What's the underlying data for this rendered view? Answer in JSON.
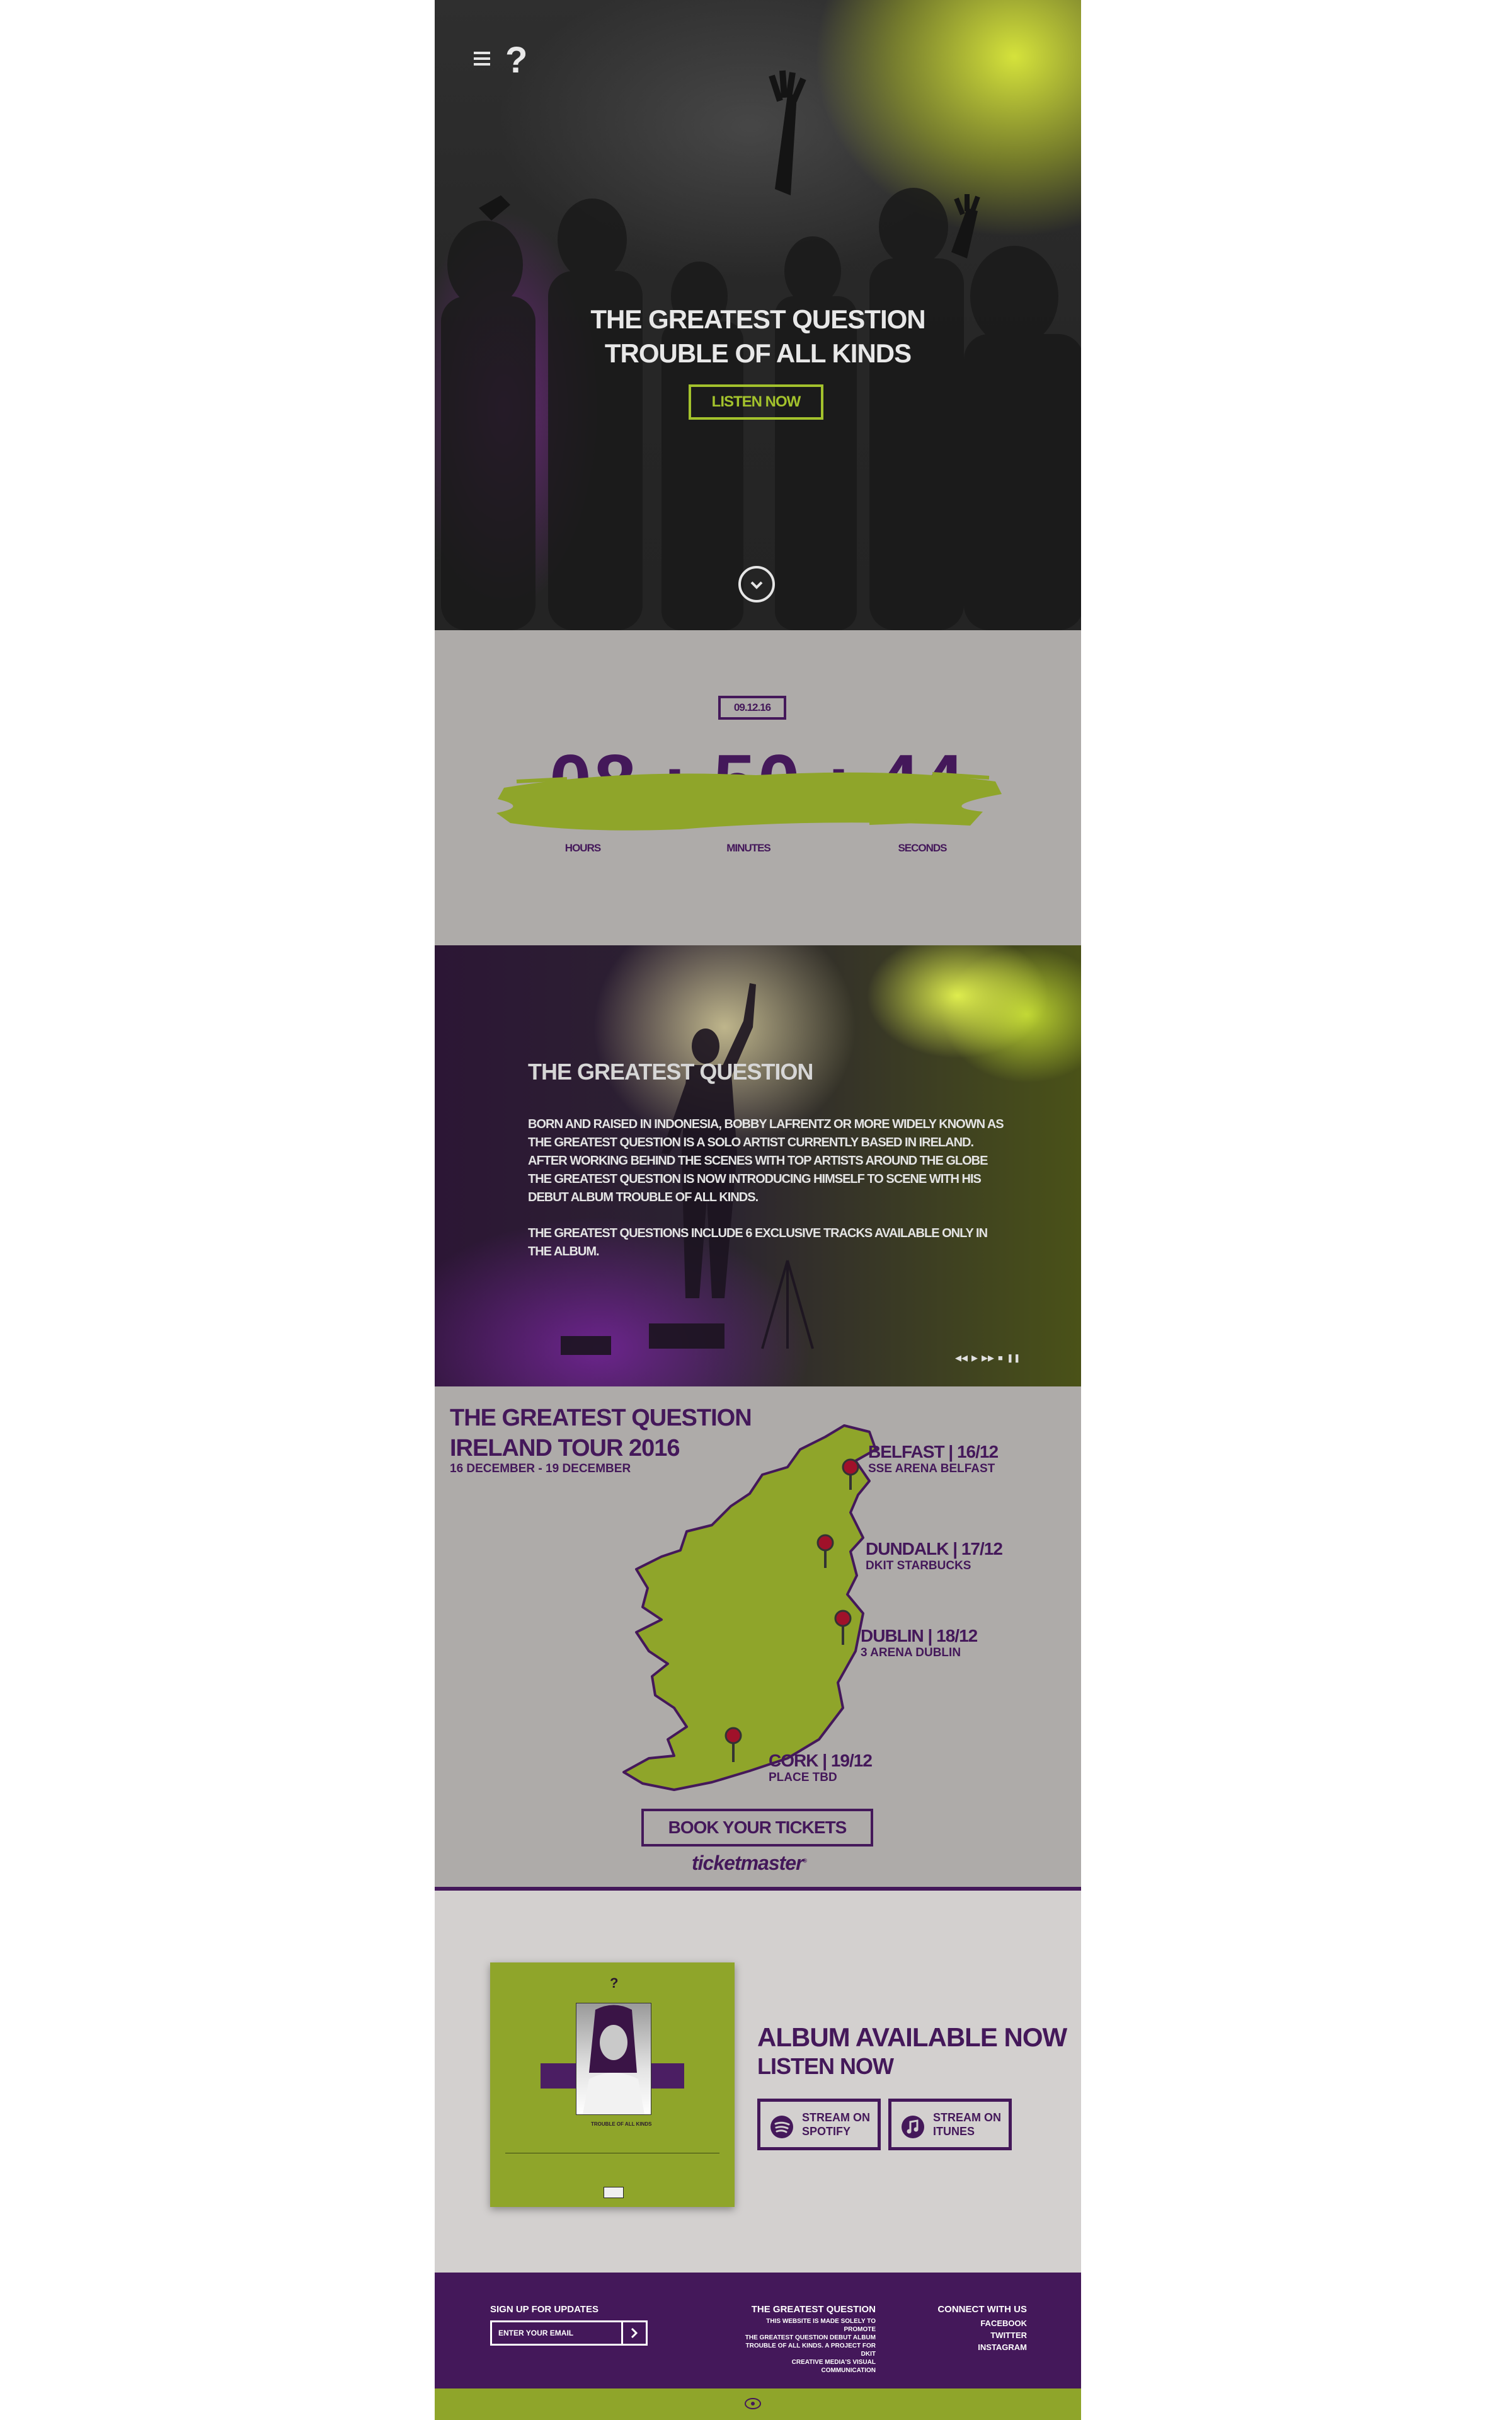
{
  "hero": {
    "logo": "?",
    "title_line1": "THE GREATEST QUESTION",
    "title_line2": "TROUBLE OF ALL KINDS",
    "listen_label": "LISTEN NOW"
  },
  "countdown": {
    "date": "09.12.16",
    "digits": "08 : 50 : 44",
    "units": [
      "HOURS",
      "MINUTES",
      "SECONDS"
    ]
  },
  "about": {
    "title": "THE GREATEST QUESTION",
    "paragraph1": "BORN AND RAISED IN INDONESIA, BOBBY LAFRENTZ OR MORE WIDELY KNOWN AS THE GREATEST QUESTION IS A SOLO ARTIST CURRENTLY BASED IN IRELAND. AFTER WORKING BEHIND THE SCENES WITH TOP ARTISTS AROUND THE GLOBE THE GREATEST QUESTION IS NOW INTRODUCING HIMSELF TO SCENE WITH HIS DEBUT ALBUM TROUBLE OF ALL KINDS.",
    "paragraph2": "THE GREATEST QUESTIONS INCLUDE 6 EXCLUSIVE TRACKS AVAILABLE ONLY IN THE ALBUM.",
    "player_controls": [
      "◀◀",
      "▶",
      "▶▶",
      "■",
      "❚❚"
    ]
  },
  "tour": {
    "title_line1": "THE GREATEST QUESTION",
    "title_line2": "IRELAND TOUR 2016",
    "dates": "16 DECEMBER - 19 DECEMBER",
    "stops": [
      {
        "city": "BELFAST | 16/12",
        "venue": "SSE ARENA BELFAST"
      },
      {
        "city": "DUNDALK | 17/12",
        "venue": "DKIT STARBUCKS"
      },
      {
        "city": "DUBLIN | 18/12",
        "venue": "3 ARENA DUBLIN"
      },
      {
        "city": "CORK | 19/12",
        "venue": "PLACE TBD"
      }
    ],
    "book_label": "BOOK YOUR TICKETS",
    "ticket_vendor": "ticketmaster",
    "map_color": "#8fa52a",
    "pin_color": "#a0112a"
  },
  "album": {
    "cover_mark": "?",
    "cover_title": "TROUBLE OF ALL KINDS",
    "headline": "ALBUM AVAILABLE NOW",
    "subline": "LISTEN NOW",
    "stream_spotify_1": "STREAM ON",
    "stream_spotify_2": "SPOTIFY",
    "stream_itunes_1": "STREAM ON",
    "stream_itunes_2": "ITUNES"
  },
  "footer": {
    "signup_label": "SIGN UP FOR UPDATES",
    "email_placeholder": "ENTER YOUR EMAIL",
    "about_heading": "THE GREATEST QUESTION",
    "about_text_1": "THIS WEBSITE IS MADE SOLELY TO PROMOTE",
    "about_text_2": "THE GREATEST QUESTION DEBUT ALBUM",
    "about_text_3": "TROUBLE OF ALL KINDS. A PROJECT FOR DKIT",
    "about_text_4": "CREATIVE MEDIA'S VISUAL COMMUNICATION",
    "connect_heading": "CONNECT WITH US",
    "links": [
      "FACEBOOK",
      "TWITTER",
      "INSTAGRAM"
    ]
  },
  "colors": {
    "purple": "#44185a",
    "green": "#8fa52a",
    "lime": "#a3c22c",
    "grey": "#aeaba9"
  }
}
